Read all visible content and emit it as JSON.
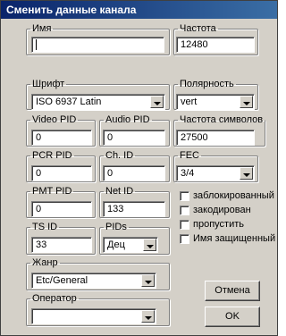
{
  "window": {
    "title": "Сменить данные канала"
  },
  "fields": {
    "name": {
      "label": "Имя",
      "value": ""
    },
    "frequency": {
      "label": "Частота",
      "value": "12480"
    },
    "font": {
      "label": "Шрифт",
      "value": "ISO 6937 Latin"
    },
    "polarity": {
      "label": "Полярность",
      "value": "vert"
    },
    "video_pid": {
      "label": "Video PID",
      "value": "0"
    },
    "audio_pid": {
      "label": "Audio PID",
      "value": "0"
    },
    "symbol_rate": {
      "label": "Частота символов",
      "value": "27500"
    },
    "pcr_pid": {
      "label": "PCR PID",
      "value": "0"
    },
    "ch_id": {
      "label": "Ch. ID",
      "value": "0"
    },
    "fec": {
      "label": "FEC",
      "value": "3/4"
    },
    "pmt_pid": {
      "label": "PMT PID",
      "value": "0"
    },
    "net_id": {
      "label": "Net ID",
      "value": "133"
    },
    "ts_id": {
      "label": "TS ID",
      "value": "33"
    },
    "pids": {
      "label": "PIDs",
      "value": "Дец"
    },
    "genre": {
      "label": "Жанр",
      "value": "Etc/General"
    },
    "operator": {
      "label": "Оператор",
      "value": ""
    }
  },
  "checkboxes": [
    {
      "label": "заблокированный",
      "checked": false
    },
    {
      "label": "закодирован",
      "checked": false
    },
    {
      "label": "пропустить",
      "checked": false
    },
    {
      "label": "Имя защищенный",
      "checked": false
    }
  ],
  "buttons": {
    "cancel": "Отмена",
    "ok": "OK"
  }
}
